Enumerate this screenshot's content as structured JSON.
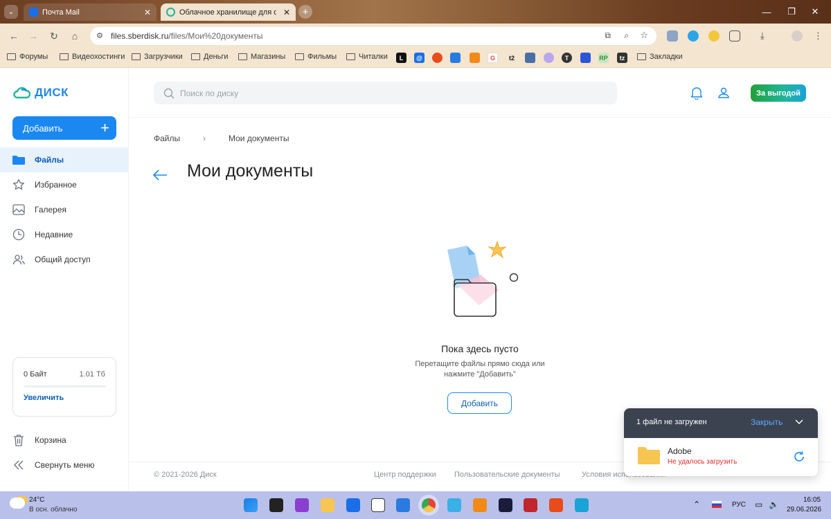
{
  "browser": {
    "tabs": [
      {
        "title": "Почта Mail",
        "active": false
      },
      {
        "title": "Облачное хранилище для фа",
        "active": true
      }
    ],
    "url_host": "files.sberdisk.ru",
    "url_path": "/files/Мои%20документы",
    "bookmarks": [
      "Форумы",
      "Видеохостинги",
      "Загрузчики",
      "Деньги",
      "Магазины",
      "Фильмы",
      "Читалки",
      "Закладки"
    ]
  },
  "app": {
    "logo_text": "ДИСК",
    "add_label": "Добавить",
    "nav": [
      {
        "label": "Файлы",
        "icon": "folder-icon",
        "active": true
      },
      {
        "label": "Избранное",
        "icon": "star-icon",
        "active": false
      },
      {
        "label": "Галерея",
        "icon": "gallery-icon",
        "active": false
      },
      {
        "label": "Недавние",
        "icon": "clock-icon",
        "active": false
      },
      {
        "label": "Общий доступ",
        "icon": "users-icon",
        "active": false
      }
    ],
    "storage": {
      "used": "0 Байт",
      "total": "1.01 Тб",
      "fraction_used": 0,
      "upgrade": "Увеличить"
    },
    "trash_label": "Корзина",
    "collapse_label": "Свернуть меню",
    "search_placeholder": "Поиск по диску",
    "promo_label": "За выгодой",
    "breadcrumb": {
      "root": "Файлы",
      "separator": "›",
      "current": "Мои документы"
    },
    "page_title": "Мои документы",
    "empty": {
      "title": "Пока здесь пусто",
      "line1": "Перетащите файлы прямо сюда или",
      "line2": "нажмите \"Добавить\"",
      "button": "Добавить"
    },
    "footer": {
      "copyright": "© 2021-2026 Диск",
      "support": "Центр поддержки",
      "docs": "Пользовательские документы",
      "terms": "Условия использования"
    },
    "toast": {
      "header": "1 файл не загружен",
      "close": "Закрыть",
      "file_name": "Adobe",
      "status": "Не удалось загрузить"
    },
    "colors": {
      "accent": "#1a88f0",
      "error": "#e02b2b",
      "promo_start": "#21a038",
      "promo_end": "#1aa3d6"
    }
  },
  "taskbar": {
    "weather_temp": "24°C",
    "weather_desc": "В осн. облачно",
    "lang": "РУС",
    "time": "16:05",
    "date": "29.06.2026"
  }
}
